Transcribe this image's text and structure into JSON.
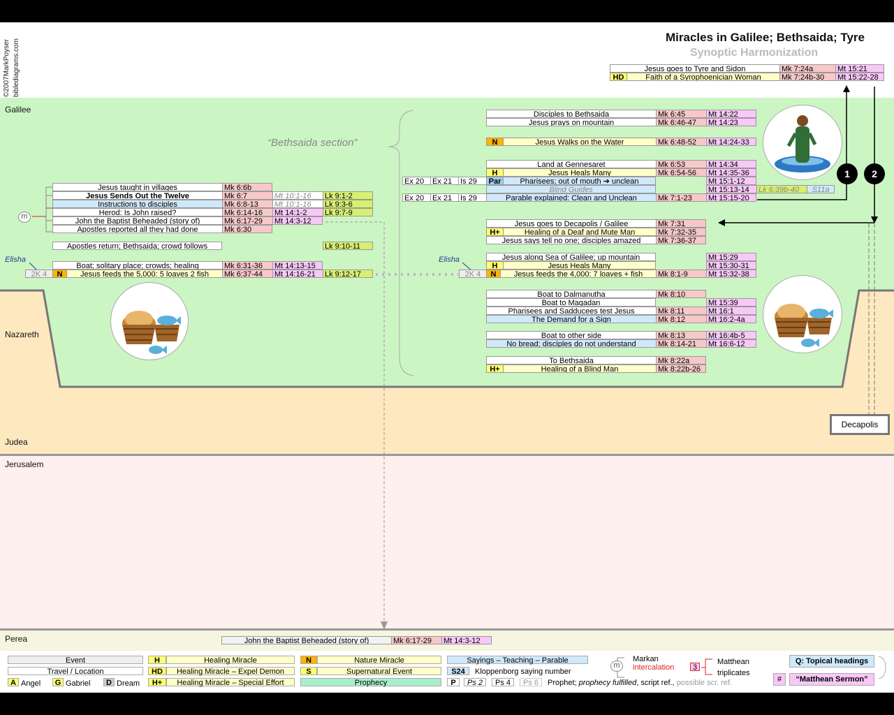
{
  "title": "Miracles in Galilee; Bethsaida; Tyre",
  "subtitle": "Synoptic Harmonization",
  "credit": [
    "©2007MarkPoyser",
    "biblediagrams.com"
  ],
  "regions": {
    "galilee": "Galilee",
    "nazareth": "Nazareth",
    "judea": "Judea",
    "jerusalem": "Jerusalem",
    "perea": "Perea",
    "decapolis": "Decapolis"
  },
  "section_label": "“Bethsaida section”",
  "elisha": "Elisha",
  "markers": [
    "1",
    "2"
  ],
  "m_marker": "m",
  "tyre": {
    "r1": {
      "text": "Jesus goes to Tyre and Sidon",
      "mk": "Mk 7:24a",
      "mt": "Mt 15:21"
    },
    "r2": {
      "tag": "HD",
      "text": "Faith of a Syrophoenician Woman",
      "mk": "Mk 7:24b-30",
      "mt": "Mt 15:22-28"
    }
  },
  "left": {
    "r1": {
      "text": "Jesus taught in villages",
      "mk": "Mk 6:6b"
    },
    "r2": {
      "text": "Jesus Sends Out the Twelve",
      "mk": "Mk 6:7",
      "mt": "Mt 10:1-16",
      "lk": "Lk 9:1-2"
    },
    "r3": {
      "text": "Instructions to disciples",
      "mk": "Mk 6:8-13",
      "mt": "Mt 10:1-16",
      "lk": "Lk 9:3-6"
    },
    "r4": {
      "text": "Herod: Is John raised?",
      "mk": "Mk 6:14-16",
      "mt": "Mt 14:1-2",
      "lk": "Lk 9:7-9"
    },
    "r5": {
      "text": "John the Baptist Beheaded (story of)",
      "mk": "Mk 6:17-29",
      "mt": "Mt 14:3-12"
    },
    "r6": {
      "text": "Apostles reported all they had done",
      "mk": "Mk 6:30"
    },
    "r7": {
      "text": "Apostles return; Bethsaida; crowd follows",
      "lk": "Lk 9:10-11"
    },
    "r8": {
      "text": "Boat; solitary place; crowds; healing",
      "mk": "Mk 6:31-36",
      "mt": "Mt 14:13-15"
    },
    "r9": {
      "ref": "2K 4",
      "tag": "N",
      "text": "Jesus feeds the 5,000: 5 loaves 2 fish",
      "mk": "Mk 6:37-44",
      "mt": "Mt 14:16-21",
      "lk": "Lk 9:12-17"
    }
  },
  "right": {
    "a1": {
      "text": "Disciples to Bethsaida",
      "mk": "Mk 6:45",
      "mt": "Mt 14:22"
    },
    "a2": {
      "text": "Jesus prays on mountain",
      "mk": "Mk 6:46-47",
      "mt": "Mt 14:23"
    },
    "b1": {
      "tag": "N",
      "text": "Jesus Walks on the Water",
      "mk": "Mk 6:48-52",
      "mt": "Mt 14:24-33"
    },
    "c1": {
      "text": "Land at Gennesaret",
      "mk": "Mk 6:53",
      "mt": "Mt 14:34"
    },
    "c2": {
      "tag": "H",
      "text": "Jesus Heals Many",
      "mk": "Mk 6:54-56",
      "mt": "Mt 14:35-36"
    },
    "c3": {
      "ex20": "Ex 20",
      "ex21": "Ex 21",
      "is29": "Is 29",
      "tag": "Par",
      "text": "Pharisees; out of mouth ➔ unclean",
      "mt": "Mt 15:1-12"
    },
    "c4": {
      "text": "Blind Guides",
      "mt": "Mt 15:13-14",
      "lk": "Lk 6:39b-40",
      "s": "S11a"
    },
    "c5": {
      "ex20": "Ex 20",
      "ex21": "Ex 21",
      "is29": "Is 29",
      "text": "Parable explained: Clean and Unclean",
      "mk": "Mk 7:1-23",
      "mt": "Mt 15:15-20"
    },
    "d1": {
      "text": "Jesus goes to Decapolis / Galilee",
      "mk": "Mk 7:31"
    },
    "d2": {
      "tag": "H+",
      "text": "Healing of a Deaf and Mute Man",
      "mk": "Mk 7:32-35"
    },
    "d3": {
      "text": "Jesus says tell no one; disciples amazed",
      "mk": "Mk 7:36-37"
    },
    "e1": {
      "text": "Jesus along Sea of Galilee; up mountain",
      "mt": "Mt 15:29"
    },
    "e2": {
      "tag": "H",
      "text": "Jesus Heals Many",
      "mt": "Mt 15:30-31"
    },
    "e3": {
      "ref": "2K 4",
      "tag": "N",
      "text": "Jesus feeds the 4,000: 7 loaves + fish",
      "mk": "Mk 8:1-9",
      "mt": "Mt 15:32-38"
    },
    "f1": {
      "text": "Boat to Dalmanutha",
      "mk": "Mk 8:10"
    },
    "f2": {
      "text": "Boat to Magadan",
      "mt": "Mt 15:39"
    },
    "f3": {
      "text": "Pharisees and Sadducees test Jesus",
      "mk": "Mk 8:11",
      "mt": "Mt 16:1"
    },
    "f4": {
      "text": "The Demand for a Sign",
      "mk": "Mk 8:12",
      "mt": "Mt 16:2-4a"
    },
    "g1": {
      "text": "Boat to other side",
      "mk": "Mk 8:13",
      "mt": "Mt 16:4b-5"
    },
    "g2": {
      "text": "No bread; disciples do not understand",
      "mk": "Mk 8:14-21",
      "mt": "Mt 16:6-12"
    },
    "h1": {
      "text": "To Bethsaida",
      "mk": "Mk 8:22a"
    },
    "h2": {
      "tag": "H+",
      "text": "Healing of a Blind Man",
      "mk": "Mk 8:22b-26"
    }
  },
  "perea_row": {
    "text": "John the Baptist Beheaded (story of)",
    "mk": "Mk 6:17-29",
    "mt": "Mt 14:3-12"
  },
  "legend": {
    "event": "Event",
    "travel": "Travel / Location",
    "angel_tag": "A",
    "angel": "Angel",
    "gabriel_tag": "G",
    "gabriel": "Gabriel",
    "dream_tag": "D",
    "dream": "Dream",
    "h_tag": "H",
    "h": "Healing Miracle",
    "hd_tag": "HD",
    "hd": "Healing Miracle – Expel Demon",
    "hp_tag": "H+",
    "hp": "Healing Miracle – Special Effort",
    "n_tag": "N",
    "n": "Nature Miracle",
    "s_tag": "S",
    "s": "Supernatural Event",
    "prophecy": "Prophecy",
    "sayings": "Sayings – Teaching – Parable",
    "s24_tag": "S24",
    "s24": "Kloppenborg saying number",
    "p_tag": "P",
    "ps2": "Ps 2",
    "ps4": "Ps 4",
    "ps6": "Ps 6",
    "prophet_a": "Prophet;",
    "prophet_b": "prophecy fulfilled",
    "prophet_c": ", script ref.,",
    "prophet_d": "possible scr. ref.",
    "markan": "Markan",
    "intercalation": "intercalation",
    "three": "3",
    "matthean": "Matthean",
    "triplicates": "triplicates",
    "q": "Q: Topical headings",
    "hash": "#",
    "sermon": "“Matthean Sermon”"
  },
  "colors": {
    "galilee": "#ccf5c4",
    "judea": "#fde8c0",
    "jerusalem": "#fdf0ef",
    "perea": "#f5f5e0",
    "mark": "#f8c8c8",
    "matthew": "#f8c8f8",
    "luke": "#d8f070"
  },
  "icons": [
    "bread-basket-icon",
    "jesus-walking-icon",
    "arrow-icon"
  ]
}
